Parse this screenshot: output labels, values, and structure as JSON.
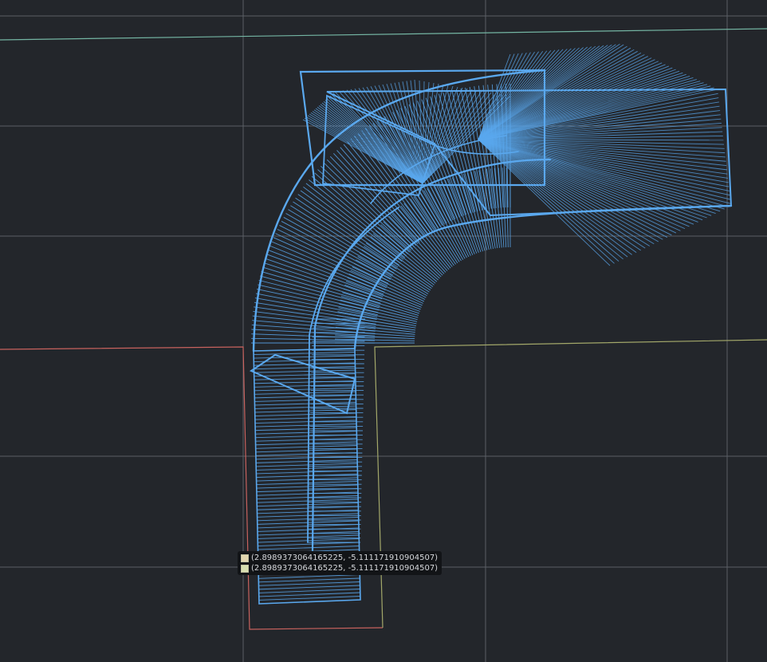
{
  "colors": {
    "background": "#23262b",
    "grid": "#5b5f66",
    "sweep": "#5aa8ee",
    "axis_teal": "#74b5a3",
    "axis_red": "#c8625e",
    "axis_olive": "#a3a86a",
    "tooltip_bg": "#121417",
    "swatch_1": "#e2d6ae",
    "swatch_2": "#d8e0b0"
  },
  "tooltip": {
    "rows": [
      {
        "label": "(2.8989373064165225, -5.111171910904507)"
      },
      {
        "label": "(2.8989373064165225, -5.111171910904507)"
      }
    ]
  }
}
